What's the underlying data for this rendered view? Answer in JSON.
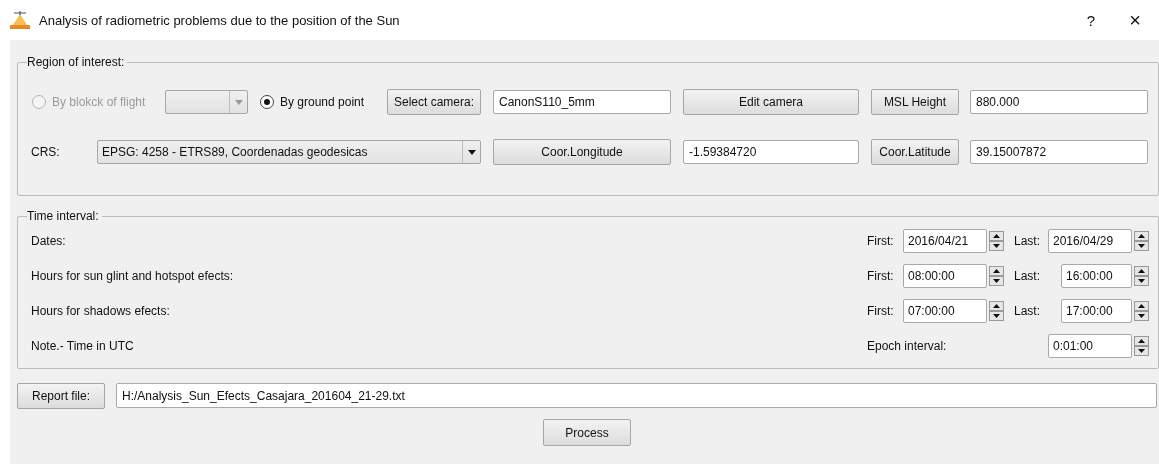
{
  "window": {
    "title": "Analysis of radiometric problems due to the position of the Sun",
    "buttons": [
      "?",
      "×"
    ]
  },
  "region_of_interest": {
    "title": "Region of interest:",
    "mode_options": [
      {
        "label": "By blokck of flight",
        "selected": false,
        "disabled": true
      },
      {
        "label": "By ground point",
        "selected": true,
        "disabled": false
      }
    ],
    "block_combo": {
      "disabled": true
    },
    "select_camera_button": "Select camera:",
    "camera_field": "CanonS110_5mm",
    "edit_camera_button": "Edit camera",
    "msl_height_button": "MSL Height",
    "msl_height_field": "880.000",
    "crs_label": "CRS:",
    "crs_combo": "EPSG:  4258 - ETRS89, Coordenadas geodesicas",
    "longitude_button": "Coor.Longitude",
    "longitude_field": "-1.59384720",
    "latitude_button": "Coor.Latitude",
    "latitude_field": "39.15007872"
  },
  "time_interval": {
    "title": "Time interval:",
    "rows": [
      {
        "kind": "date_range",
        "label": "Dates:",
        "first_label": "First:",
        "first": "2016/04/21",
        "last_label": "Last:",
        "last": "2016/04/29"
      },
      {
        "kind": "time_range",
        "label": "Hours for sun glint and hotspot efects:",
        "first_label": "First:",
        "first": "08:00:00",
        "last_label": "Last:",
        "last": "16:00:00"
      },
      {
        "kind": "time_range",
        "label": "Hours for shadows efects:",
        "first_label": "First:",
        "first": "07:00:00",
        "last_label": "Last:",
        "last": "17:00:00"
      },
      {
        "kind": "epoch",
        "label": "Note.- Time in UTC",
        "value_label": "Epoch interval:",
        "value": "0:01:00"
      }
    ]
  },
  "report_file_button": "Report file:",
  "report_file_field": "H:/Analysis_Sun_Efects_Casajara_201604_21-29.txt",
  "process_button": "Process"
}
